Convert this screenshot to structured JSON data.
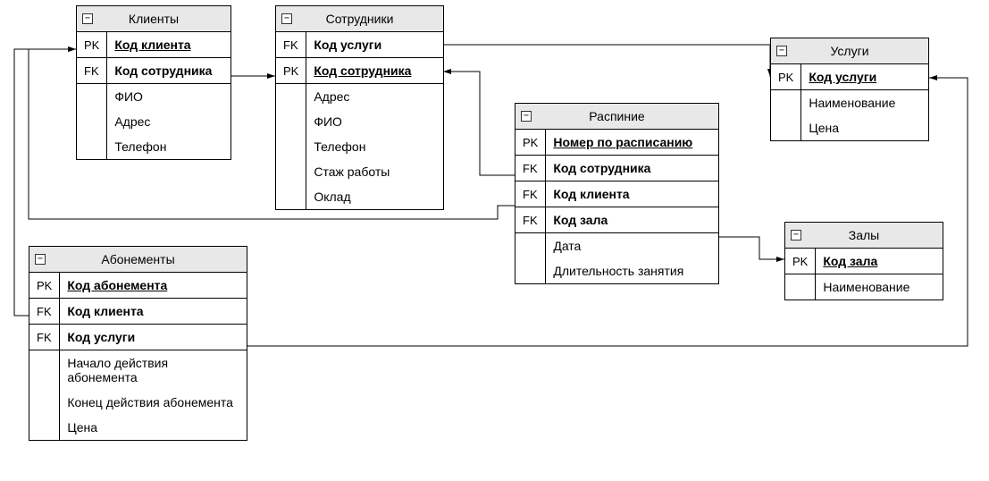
{
  "entities": {
    "clients": {
      "title": "Клиенты",
      "rows": [
        {
          "key": "PK",
          "name": "Код клиента",
          "pk": true
        },
        {
          "key": "FK",
          "name": "Код сотрудника",
          "pk": false,
          "bold": true
        },
        {
          "key": "",
          "name": "ФИО"
        },
        {
          "key": "",
          "name": "Адрес"
        },
        {
          "key": "",
          "name": "Телефон"
        }
      ]
    },
    "employees": {
      "title": "Сотрудники",
      "rows": [
        {
          "key": "FK",
          "name": "Код услуги",
          "pk": false,
          "bold": true
        },
        {
          "key": "PK",
          "name": "Код сотрудника",
          "pk": true
        },
        {
          "key": "",
          "name": "Адрес"
        },
        {
          "key": "",
          "name": "ФИО"
        },
        {
          "key": "",
          "name": "Телефон"
        },
        {
          "key": "",
          "name": "Стаж работы"
        },
        {
          "key": "",
          "name": "Оклад"
        }
      ]
    },
    "services": {
      "title": "Услуги",
      "rows": [
        {
          "key": "PK",
          "name": "Код услуги",
          "pk": true
        },
        {
          "key": "",
          "name": "Наименование"
        },
        {
          "key": "",
          "name": "Цена"
        }
      ]
    },
    "schedule": {
      "title": "Распиние",
      "rows": [
        {
          "key": "PK",
          "name": "Номер по расписанию",
          "pk": true
        },
        {
          "key": "FK",
          "name": "Код сотрудника",
          "bold": true
        },
        {
          "key": "FK",
          "name": "Код клиента",
          "bold": true
        },
        {
          "key": "FK",
          "name": "Код зала",
          "bold": true
        },
        {
          "key": "",
          "name": "Дата"
        },
        {
          "key": "",
          "name": "Длительность занятия"
        }
      ]
    },
    "subscriptions": {
      "title": "Абонементы",
      "rows": [
        {
          "key": "PK",
          "name": "Код абонемента",
          "pk": true
        },
        {
          "key": "FK",
          "name": "Код клиента",
          "bold": true
        },
        {
          "key": "FK",
          "name": "Код услуги",
          "bold": true
        },
        {
          "key": "",
          "name": "Начало действия абонемента"
        },
        {
          "key": "",
          "name": "Конец действия абонемента"
        },
        {
          "key": "",
          "name": "Цена"
        }
      ]
    },
    "halls": {
      "title": "Залы",
      "rows": [
        {
          "key": "PK",
          "name": "Код зала",
          "pk": true
        },
        {
          "key": "",
          "name": "Наименование"
        }
      ]
    }
  },
  "collapse_glyph": "−"
}
